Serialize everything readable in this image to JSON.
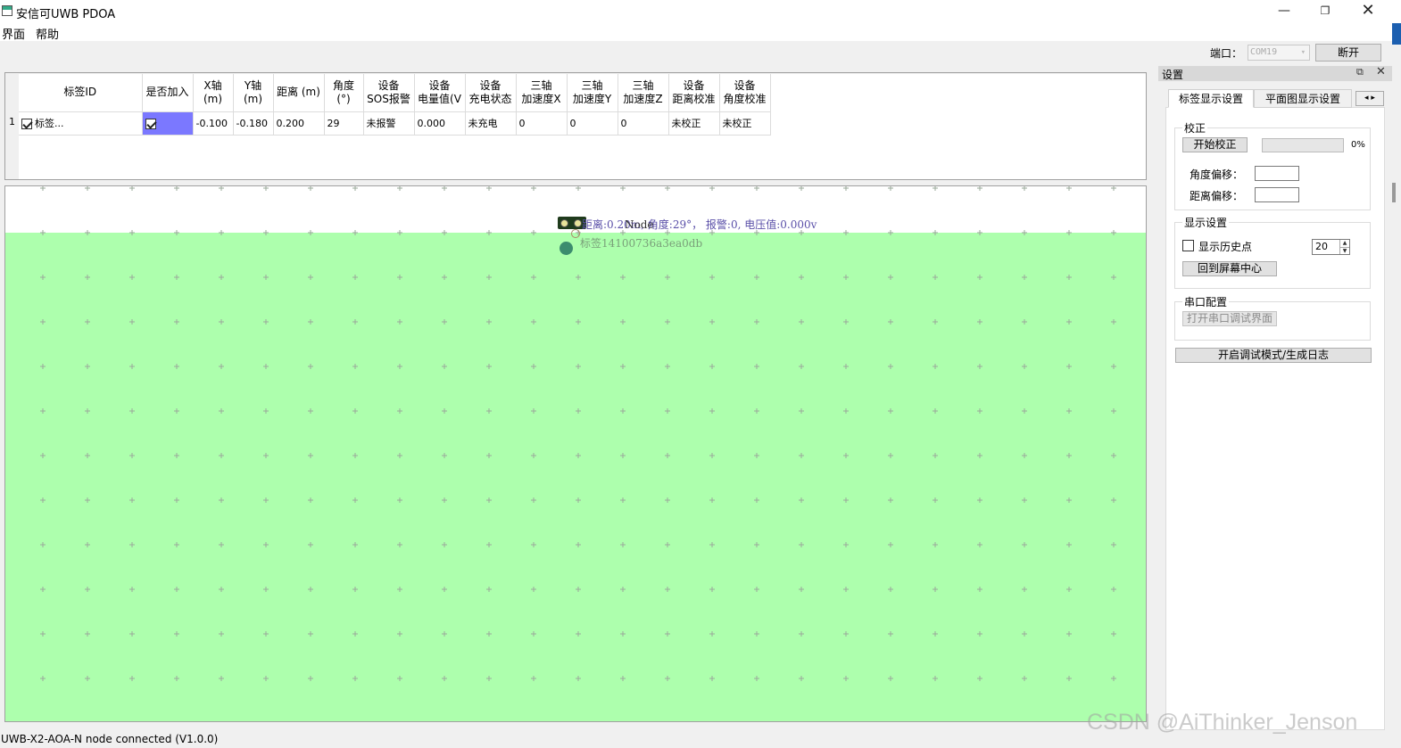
{
  "window": {
    "title": "安信可UWB PDOA",
    "minimize_glyph": "—",
    "maximize_glyph": "❐",
    "close_glyph": "✕"
  },
  "menu": {
    "view": "界面",
    "help": "帮助"
  },
  "port": {
    "label": "端口：",
    "selected": "COM19",
    "disconnect_label": "断开"
  },
  "table": {
    "columns": [
      "标签ID",
      "是否加入",
      "X轴\n(m)",
      "Y轴\n(m)",
      "距离 (m)",
      "角度 (°)",
      "设备\nSOS报警",
      "设备\n电量值(V",
      "设备\n充电状态",
      "三轴\n加速度X",
      "三轴\n加速度Y",
      "三轴\n加速度Z",
      "设备\n距离校准",
      "设备\n角度校准"
    ],
    "rows": [
      {
        "row_number": "1",
        "tag_id": "标签...",
        "x": "-0.100",
        "y": "-0.180",
        "distance": "0.200",
        "angle": "29",
        "sos": "未报警",
        "battery": "0.000",
        "charging": "未充电",
        "accel_x": "0",
        "accel_y": "0",
        "accel_z": "0",
        "distance_calib": "未校正",
        "angle_calib": "未校正"
      }
    ]
  },
  "plot": {
    "node_label": "Node",
    "node_info": "距离:0.20m, 角度:29°， 报警:0, 电压值:0.000v",
    "tag_label": "标签14100736a3ea0db"
  },
  "settings": {
    "title": "设置",
    "float_glyph": "⧉",
    "close_glyph": "✕",
    "tabs": [
      "标签显示设置",
      "平面图显示设置"
    ],
    "tab_scroll_glyph": "◂ ▸",
    "calibration": {
      "title": "校正",
      "start_button": "开始校正",
      "progress": "0%",
      "angle_offset_label": "角度偏移：",
      "distance_offset_label": "距离偏移："
    },
    "display": {
      "title": "显示设置",
      "show_history_label": "显示历史点",
      "history_count": "20",
      "recenter_button": "回到屏幕中心"
    },
    "serial": {
      "title": "串口配置",
      "open_debug_button": "打开串口调试界面"
    },
    "debug_mode_button": "开启调试模式/生成日志"
  },
  "status_bar": {
    "text": "UWB-X2-AOA-N node connected (V1.0.0)"
  },
  "watermark": "CSDN @AiThinker_Jenson"
}
